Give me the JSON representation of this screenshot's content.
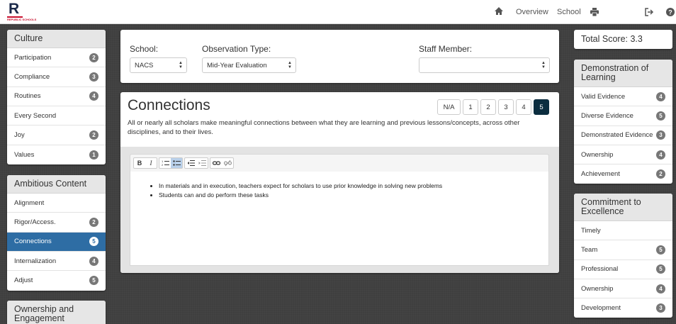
{
  "brand": {
    "logo_letter": "R",
    "logo_sub": "REPUBLIC SCHOOLS"
  },
  "nav": {
    "overview": "Overview",
    "school": "School"
  },
  "culture": {
    "title": "Culture",
    "items": [
      {
        "label": "Participation",
        "badge": "2"
      },
      {
        "label": "Compliance",
        "badge": "3"
      },
      {
        "label": "Routines",
        "badge": "4"
      },
      {
        "label": "Every Second",
        "badge": ""
      },
      {
        "label": "Joy",
        "badge": "2"
      },
      {
        "label": "Values",
        "badge": "1"
      }
    ]
  },
  "ambitious": {
    "title": "Ambitious Content",
    "items": [
      {
        "label": "Alignment",
        "badge": ""
      },
      {
        "label": "Rigor/Access.",
        "badge": "2"
      },
      {
        "label": "Connections",
        "badge": "5"
      },
      {
        "label": "Internalization",
        "badge": "4"
      },
      {
        "label": "Adjust",
        "badge": "5"
      }
    ]
  },
  "ownership": {
    "title": "Ownership and Engagement"
  },
  "filters": {
    "school_label": "School:",
    "school_value": "NACS",
    "observation_label": "Observation Type:",
    "observation_value": "Mid-Year Evaluation",
    "staff_label": "Staff Member:",
    "staff_value": ""
  },
  "card": {
    "title": "Connections",
    "description": "All or nearly all scholars make meaningful connections between what they are learning and previous lessons/concepts, across other disciplines, and to their lives.",
    "scores": [
      "N/A",
      "1",
      "2",
      "3",
      "4",
      "5"
    ],
    "selected_score": "5",
    "bullets": [
      "In materials and in execution, teachers expect for scholars to use prior knowledge in solving new problems",
      "Students can and do perform these tasks"
    ]
  },
  "toolbar": {
    "bold": "B",
    "italic": "I"
  },
  "total": {
    "label": "Total Score: 3.3"
  },
  "demonstration": {
    "title": "Demonstration of Learning",
    "items": [
      {
        "label": "Valid Evidence",
        "badge": "4"
      },
      {
        "label": "Diverse Evidence",
        "badge": "5"
      },
      {
        "label": "Demonstrated Evidence",
        "badge": "3"
      },
      {
        "label": "Ownership",
        "badge": "4"
      },
      {
        "label": "Achievement",
        "badge": "2"
      }
    ]
  },
  "commitment": {
    "title": "Commitment to Excellence",
    "items": [
      {
        "label": "Timely",
        "badge": ""
      },
      {
        "label": "Team",
        "badge": "5"
      },
      {
        "label": "Professional",
        "badge": "5"
      },
      {
        "label": "Ownership",
        "badge": "4"
      },
      {
        "label": "Development",
        "badge": "3"
      }
    ]
  },
  "colors": {
    "active": "#2e6da4",
    "selected_score": "#0b2d3f",
    "brand_red": "#c8102e"
  }
}
